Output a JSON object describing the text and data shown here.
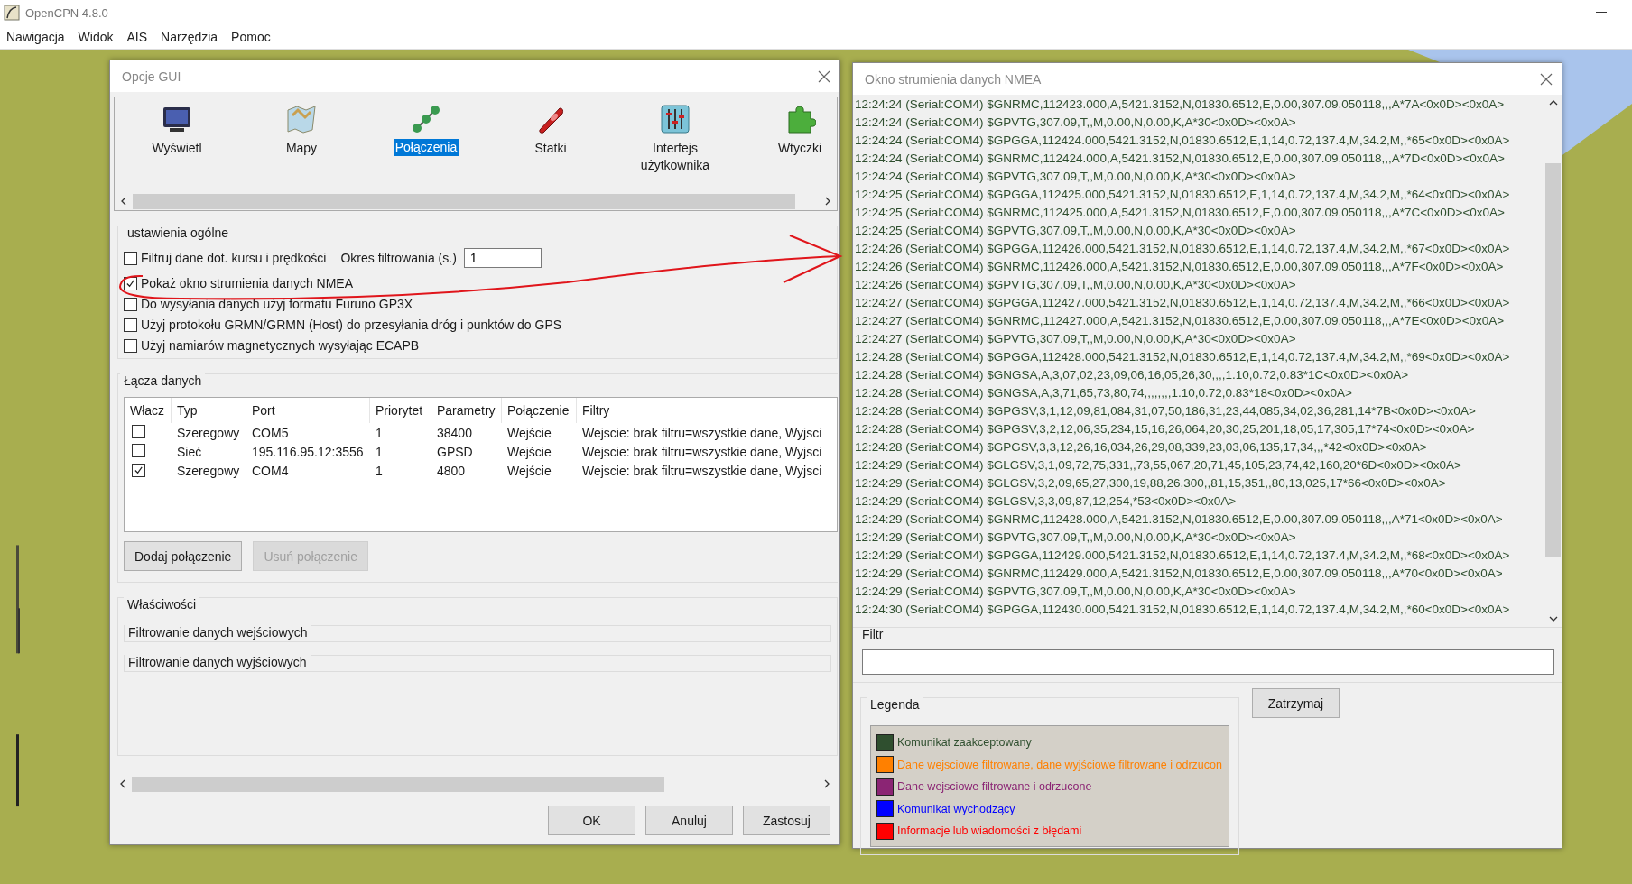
{
  "app": {
    "title": "OpenCPN 4.8.0",
    "menu": [
      "Nawigacja",
      "Widok",
      "AIS",
      "Narzędzia",
      "Pomoc"
    ]
  },
  "options_dialog": {
    "title": "Opcje GUI",
    "categories": [
      {
        "label": "Wyświetl",
        "selected": false
      },
      {
        "label": "Mapy",
        "selected": false
      },
      {
        "label": "Połączenia",
        "selected": true
      },
      {
        "label": "Statki",
        "selected": false
      },
      {
        "label": "Interfejs użytkownika",
        "selected": false
      },
      {
        "label": "Wtyczki",
        "selected": false
      }
    ],
    "general_settings": {
      "title": "ustawienia ogólne",
      "filter_checkbox": {
        "label": "Filtruj dane dot. kursu i prędkości",
        "checked": false
      },
      "filter_period": {
        "label": "Okres filtrowania (s.)",
        "value": "1"
      },
      "options": [
        {
          "label": "Pokaż okno strumienia danych NMEA",
          "checked": true
        },
        {
          "label": "Do wysyłania danych użyj formatu Furuno GP3X",
          "checked": false
        },
        {
          "label": "Użyj protokołu GRMN/GRMN (Host) do przesyłania dróg i punktów do GPS",
          "checked": false
        },
        {
          "label": "Użyj namiarów magnetycznych wysyłając ECAPB",
          "checked": false
        }
      ]
    },
    "data_links": {
      "title": "Łącza danych",
      "columns": [
        "Włacz",
        "Typ",
        "Port",
        "Priorytet",
        "Parametry",
        "Połączenie",
        "Filtry"
      ],
      "rows": [
        {
          "enabled": false,
          "cells": [
            "",
            "Szeregowy",
            "COM5",
            "1",
            "38400",
            "Wejście",
            "Wejscie: brak filtru=wszystkie dane, Wyjsci"
          ]
        },
        {
          "enabled": false,
          "cells": [
            "",
            "Sieć",
            "195.116.95.12:3556",
            "1",
            "GPSD",
            "Wejście",
            "Wejscie: brak filtru=wszystkie dane, Wyjsci"
          ]
        },
        {
          "enabled": true,
          "cells": [
            "",
            "Szeregowy",
            "COM4",
            "1",
            "4800",
            "Wejście",
            "Wejscie: brak filtru=wszystkie dane, Wyjsci"
          ]
        }
      ],
      "add_button": {
        "label": "Dodaj połączenie",
        "disabled": false
      },
      "remove_button": {
        "label": "Usuń połączenie",
        "disabled": true
      }
    },
    "properties": {
      "title": "Właściwości",
      "items": [
        "Filtrowanie danych wejściowych",
        "Filtrowanie danych wyjściowych"
      ]
    },
    "buttons": [
      "OK",
      "Anuluj",
      "Zastosuj"
    ]
  },
  "nmea_window": {
    "title": "Okno strumienia danych NMEA",
    "lines": [
      "12:24:24 (Serial:COM4) $GNRMC,112423.000,A,5421.3152,N,01830.6512,E,0.00,307.09,050118,,,A*7A<0x0D><0x0A>",
      "12:24:24 (Serial:COM4) $GPVTG,307.09,T,,M,0.00,N,0.00,K,A*30<0x0D><0x0A>",
      "12:24:24 (Serial:COM4) $GPGGA,112424.000,5421.3152,N,01830.6512,E,1,14,0.72,137.4,M,34.2,M,,*65<0x0D><0x0A>",
      "12:24:24 (Serial:COM4) $GNRMC,112424.000,A,5421.3152,N,01830.6512,E,0.00,307.09,050118,,,A*7D<0x0D><0x0A>",
      "12:24:24 (Serial:COM4) $GPVTG,307.09,T,,M,0.00,N,0.00,K,A*30<0x0D><0x0A>",
      "12:24:25 (Serial:COM4) $GPGGA,112425.000,5421.3152,N,01830.6512,E,1,14,0.72,137.4,M,34.2,M,,*64<0x0D><0x0A>",
      "12:24:25 (Serial:COM4) $GNRMC,112425.000,A,5421.3152,N,01830.6512,E,0.00,307.09,050118,,,A*7C<0x0D><0x0A>",
      "12:24:25 (Serial:COM4) $GPVTG,307.09,T,,M,0.00,N,0.00,K,A*30<0x0D><0x0A>",
      "12:24:26 (Serial:COM4) $GPGGA,112426.000,5421.3152,N,01830.6512,E,1,14,0.72,137.4,M,34.2,M,,*67<0x0D><0x0A>",
      "12:24:26 (Serial:COM4) $GNRMC,112426.000,A,5421.3152,N,01830.6512,E,0.00,307.09,050118,,,A*7F<0x0D><0x0A>",
      "12:24:26 (Serial:COM4) $GPVTG,307.09,T,,M,0.00,N,0.00,K,A*30<0x0D><0x0A>",
      "12:24:27 (Serial:COM4) $GPGGA,112427.000,5421.3152,N,01830.6512,E,1,14,0.72,137.4,M,34.2,M,,*66<0x0D><0x0A>",
      "12:24:27 (Serial:COM4) $GNRMC,112427.000,A,5421.3152,N,01830.6512,E,0.00,307.09,050118,,,A*7E<0x0D><0x0A>",
      "12:24:27 (Serial:COM4) $GPVTG,307.09,T,,M,0.00,N,0.00,K,A*30<0x0D><0x0A>",
      "12:24:28 (Serial:COM4) $GPGGA,112428.000,5421.3152,N,01830.6512,E,1,14,0.72,137.4,M,34.2,M,,*69<0x0D><0x0A>",
      "12:24:28 (Serial:COM4) $GNGSA,A,3,07,02,23,09,06,16,05,26,30,,,,1.10,0.72,0.83*1C<0x0D><0x0A>",
      "12:24:28 (Serial:COM4) $GNGSA,A,3,71,65,73,80,74,,,,,,,,1.10,0.72,0.83*18<0x0D><0x0A>",
      "12:24:28 (Serial:COM4) $GPGSV,3,1,12,09,81,084,31,07,50,186,31,23,44,085,34,02,36,281,14*7B<0x0D><0x0A>",
      "12:24:28 (Serial:COM4) $GPGSV,3,2,12,06,35,234,15,16,26,064,20,30,25,201,18,05,17,305,17*74<0x0D><0x0A>",
      "12:24:28 (Serial:COM4) $GPGSV,3,3,12,26,16,034,26,29,08,339,23,03,06,135,17,34,,,*42<0x0D><0x0A>",
      "12:24:29 (Serial:COM4) $GLGSV,3,1,09,72,75,331,,73,55,067,20,71,45,105,23,74,42,160,20*6D<0x0D><0x0A>",
      "12:24:29 (Serial:COM4) $GLGSV,3,2,09,65,27,300,19,88,26,300,,81,15,351,,80,13,025,17*66<0x0D><0x0A>",
      "12:24:29 (Serial:COM4) $GLGSV,3,3,09,87,12,254,*53<0x0D><0x0A>",
      "12:24:29 (Serial:COM4) $GNRMC,112428.000,A,5421.3152,N,01830.6512,E,0.00,307.09,050118,,,A*71<0x0D><0x0A>",
      "12:24:29 (Serial:COM4) $GPVTG,307.09,T,,M,0.00,N,0.00,K,A*30<0x0D><0x0A>",
      "12:24:29 (Serial:COM4) $GPGGA,112429.000,5421.3152,N,01830.6512,E,1,14,0.72,137.4,M,34.2,M,,*68<0x0D><0x0A>",
      "12:24:29 (Serial:COM4) $GNRMC,112429.000,A,5421.3152,N,01830.6512,E,0.00,307.09,050118,,,A*70<0x0D><0x0A>",
      "12:24:29 (Serial:COM4) $GPVTG,307.09,T,,M,0.00,N,0.00,K,A*30<0x0D><0x0A>",
      "12:24:30 (Serial:COM4) $GPGGA,112430.000,5421.3152,N,01830.6512,E,1,14,0.72,137.4,M,34.2,M,,*60<0x0D><0x0A>"
    ],
    "filter": {
      "label": "Filtr"
    },
    "legend": {
      "title": "Legenda",
      "items": [
        {
          "label": "Komunikat zaakceptowany",
          "color": "#2f4f2f"
        },
        {
          "label": "Dane wejsciowe filtrowane, dane wyjściowe filtrowane i odrzucon",
          "color": "#ff8000"
        },
        {
          "label": "Dane wejsciowe filtrowane i odrzucone",
          "color": "#8b2574"
        },
        {
          "label": "Komunikat wychodzący",
          "color": "#0000ff"
        },
        {
          "label": "Informacje lub wiadomości z błędami",
          "color": "#ff0000"
        }
      ]
    },
    "pause_button": "Zatrzymaj"
  }
}
